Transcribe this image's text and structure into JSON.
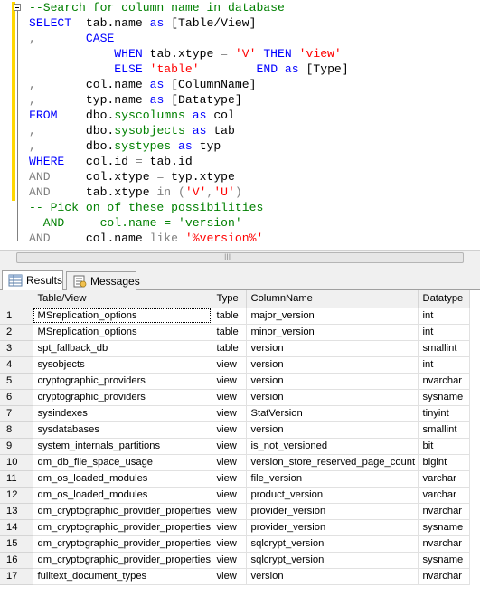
{
  "editor": {
    "lines": [
      [
        {
          "t": "--Search for column name in database",
          "c": "cm"
        }
      ],
      [
        {
          "t": "SELECT",
          "c": "kw"
        },
        {
          "t": "  tab.name "
        },
        {
          "t": "as",
          "c": "kw"
        },
        {
          "t": " [Table/View]"
        }
      ],
      [
        {
          "t": ",",
          "c": "gr"
        },
        {
          "t": "       "
        },
        {
          "t": "CASE",
          "c": "kw"
        }
      ],
      [
        {
          "t": "            "
        },
        {
          "t": "WHEN",
          "c": "kw"
        },
        {
          "t": " tab.xtype "
        },
        {
          "t": "=",
          "c": "gr"
        },
        {
          "t": " "
        },
        {
          "t": "'V'",
          "c": "st"
        },
        {
          "t": " "
        },
        {
          "t": "THEN",
          "c": "kw"
        },
        {
          "t": " "
        },
        {
          "t": "'view'",
          "c": "st"
        }
      ],
      [
        {
          "t": "            "
        },
        {
          "t": "ELSE",
          "c": "kw"
        },
        {
          "t": " "
        },
        {
          "t": "'table'",
          "c": "st"
        },
        {
          "t": "        "
        },
        {
          "t": "END",
          "c": "kw"
        },
        {
          "t": " "
        },
        {
          "t": "as",
          "c": "kw"
        },
        {
          "t": " [Type]"
        }
      ],
      [
        {
          "t": ",",
          "c": "gr"
        },
        {
          "t": "       col.name "
        },
        {
          "t": "as",
          "c": "kw"
        },
        {
          "t": " [ColumnName]"
        }
      ],
      [
        {
          "t": ",",
          "c": "gr"
        },
        {
          "t": "       typ.name "
        },
        {
          "t": "as",
          "c": "kw"
        },
        {
          "t": " [Datatype]"
        }
      ],
      [
        {
          "t": "FROM",
          "c": "kw"
        },
        {
          "t": "    dbo."
        },
        {
          "t": "syscolumns",
          "c": "fn"
        },
        {
          "t": " "
        },
        {
          "t": "as",
          "c": "kw"
        },
        {
          "t": " col"
        }
      ],
      [
        {
          "t": ",",
          "c": "gr"
        },
        {
          "t": "       dbo."
        },
        {
          "t": "sysobjects",
          "c": "fn"
        },
        {
          "t": " "
        },
        {
          "t": "as",
          "c": "kw"
        },
        {
          "t": " tab"
        }
      ],
      [
        {
          "t": ",",
          "c": "gr"
        },
        {
          "t": "       dbo."
        },
        {
          "t": "systypes",
          "c": "fn"
        },
        {
          "t": " "
        },
        {
          "t": "as",
          "c": "kw"
        },
        {
          "t": " typ"
        }
      ],
      [
        {
          "t": "WHERE",
          "c": "kw"
        },
        {
          "t": "   col.id "
        },
        {
          "t": "=",
          "c": "gr"
        },
        {
          "t": " tab.id"
        }
      ],
      [
        {
          "t": "AND",
          "c": "gr"
        },
        {
          "t": "     col.xtype "
        },
        {
          "t": "=",
          "c": "gr"
        },
        {
          "t": " typ.xtype"
        }
      ],
      [
        {
          "t": "AND",
          "c": "gr"
        },
        {
          "t": "     tab.xtype "
        },
        {
          "t": "in",
          "c": "gr"
        },
        {
          "t": " "
        },
        {
          "t": "(",
          "c": "gr"
        },
        {
          "t": "'V'",
          "c": "st"
        },
        {
          "t": ",",
          "c": "gr"
        },
        {
          "t": "'U'",
          "c": "st"
        },
        {
          "t": ")",
          "c": "gr"
        }
      ],
      [
        {
          "t": "-- Pick on of these possibilities",
          "c": "cm"
        }
      ],
      [
        {
          "t": "--AND     col.name = 'version'",
          "c": "cm"
        }
      ],
      [
        {
          "t": "AND",
          "c": "gr"
        },
        {
          "t": "     col.name "
        },
        {
          "t": "like",
          "c": "gr"
        },
        {
          "t": " "
        },
        {
          "t": "'%version%'",
          "c": "st"
        }
      ]
    ]
  },
  "tabs": {
    "results": "Results",
    "messages": "Messages"
  },
  "grid": {
    "headers": [
      "Table/View",
      "Type",
      "ColumnName",
      "Datatype"
    ],
    "rows": [
      [
        "1",
        "MSreplication_options",
        "table",
        "major_version",
        "int"
      ],
      [
        "2",
        "MSreplication_options",
        "table",
        "minor_version",
        "int"
      ],
      [
        "3",
        "spt_fallback_db",
        "table",
        "version",
        "smallint"
      ],
      [
        "4",
        "sysobjects",
        "view",
        "version",
        "int"
      ],
      [
        "5",
        "cryptographic_providers",
        "view",
        "version",
        "nvarchar"
      ],
      [
        "6",
        "cryptographic_providers",
        "view",
        "version",
        "sysname"
      ],
      [
        "7",
        "sysindexes",
        "view",
        "StatVersion",
        "tinyint"
      ],
      [
        "8",
        "sysdatabases",
        "view",
        "version",
        "smallint"
      ],
      [
        "9",
        "system_internals_partitions",
        "view",
        "is_not_versioned",
        "bit"
      ],
      [
        "10",
        "dm_db_file_space_usage",
        "view",
        "version_store_reserved_page_count",
        "bigint"
      ],
      [
        "11",
        "dm_os_loaded_modules",
        "view",
        "file_version",
        "varchar"
      ],
      [
        "12",
        "dm_os_loaded_modules",
        "view",
        "product_version",
        "varchar"
      ],
      [
        "13",
        "dm_cryptographic_provider_properties",
        "view",
        "provider_version",
        "nvarchar"
      ],
      [
        "14",
        "dm_cryptographic_provider_properties",
        "view",
        "provider_version",
        "sysname"
      ],
      [
        "15",
        "dm_cryptographic_provider_properties",
        "view",
        "sqlcrypt_version",
        "nvarchar"
      ],
      [
        "16",
        "dm_cryptographic_provider_properties",
        "view",
        "sqlcrypt_version",
        "sysname"
      ],
      [
        "17",
        "fulltext_document_types",
        "view",
        "version",
        "nvarchar"
      ]
    ]
  }
}
